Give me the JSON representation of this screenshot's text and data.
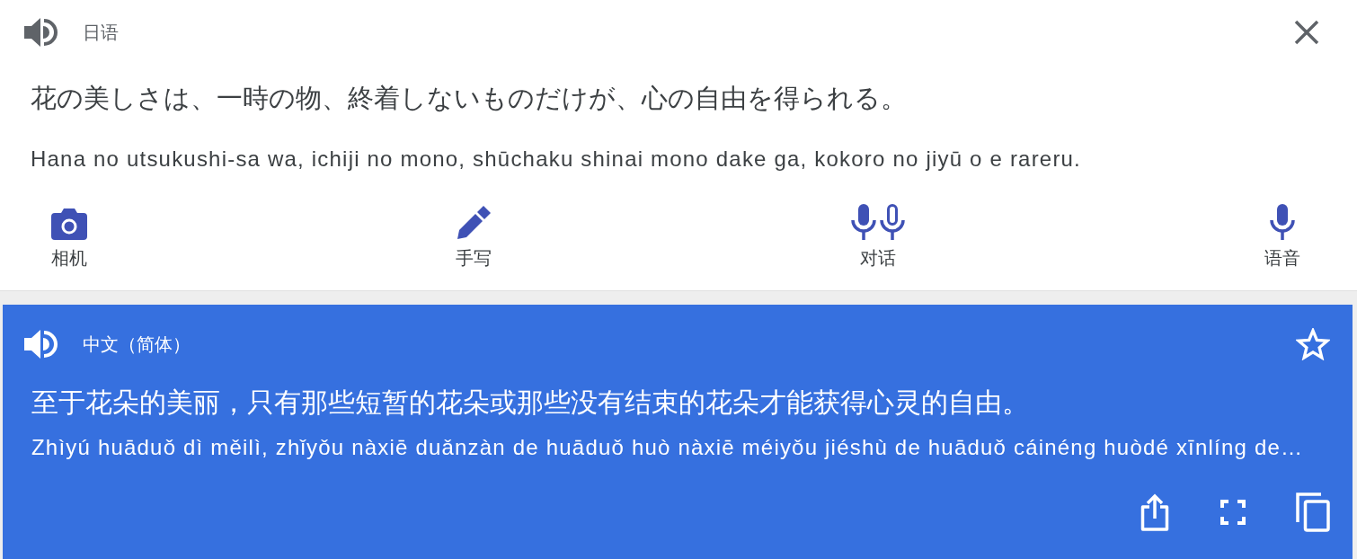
{
  "source": {
    "language": "日语",
    "text": "花の美しさは、一時の物、終着しないものだけが、心の自由を得られる。",
    "romanization": "Hana no utsukushi-sa wa, ichiji no mono, shūchaku shinai mono dake ga, kokoro no jiyū o e rareru."
  },
  "input_modes": [
    {
      "kind": "camera",
      "label": "相机"
    },
    {
      "kind": "handwriting",
      "label": "手写"
    },
    {
      "kind": "conversation",
      "label": "对话"
    },
    {
      "kind": "voice",
      "label": "语音"
    }
  ],
  "translation": {
    "language": "中文（简体）",
    "starred": false,
    "text": "至于花朵的美丽，只有那些短暂的花朵或那些没有结束的花朵才能获得心灵的自由。",
    "romanization": "Zhìyú huāduǒ dì měilì, zhǐyǒu nàxiē duǎnzàn de huāduǒ huò nàxiē méiyǒu jiéshù de huāduǒ cáinéng huòdé xīnlíng de…"
  }
}
